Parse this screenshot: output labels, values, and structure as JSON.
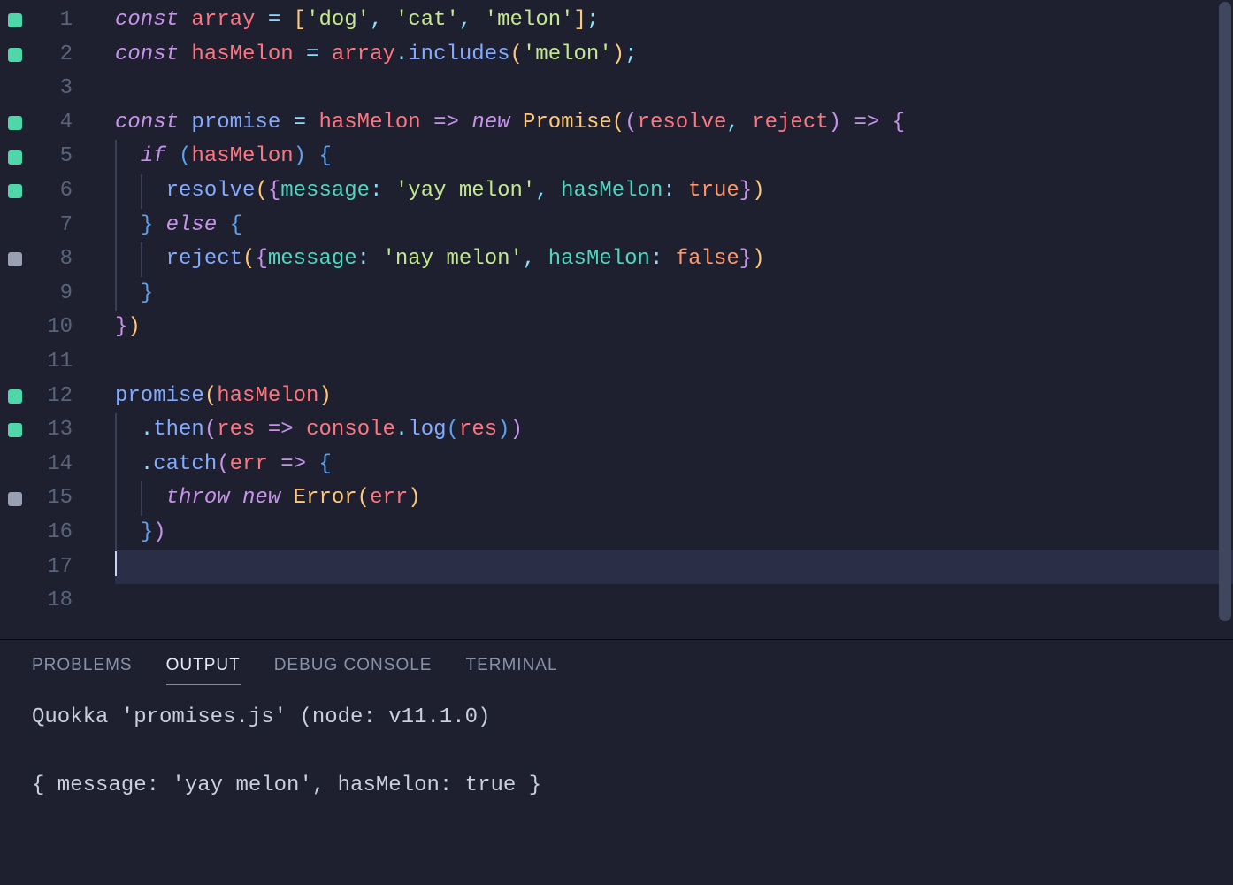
{
  "editor": {
    "lines": [
      {
        "n": 1,
        "marker": "green",
        "tokens": [
          [
            "kw",
            "const"
          ],
          [
            "var",
            " "
          ],
          [
            "ident",
            "array"
          ],
          [
            "var",
            " "
          ],
          [
            "op",
            "="
          ],
          [
            "var",
            " "
          ],
          [
            "brace-y",
            "["
          ],
          [
            "str",
            "'dog'"
          ],
          [
            "comma",
            ", "
          ],
          [
            "str",
            "'cat'"
          ],
          [
            "comma",
            ", "
          ],
          [
            "str",
            "'melon'"
          ],
          [
            "brace-y",
            "]"
          ],
          [
            "punc",
            ";"
          ]
        ]
      },
      {
        "n": 2,
        "marker": "green",
        "tokens": [
          [
            "kw",
            "const"
          ],
          [
            "var",
            " "
          ],
          [
            "ident",
            "hasMelon"
          ],
          [
            "var",
            " "
          ],
          [
            "op",
            "="
          ],
          [
            "var",
            " "
          ],
          [
            "ident",
            "array"
          ],
          [
            "punc",
            "."
          ],
          [
            "method",
            "includes"
          ],
          [
            "brace-y",
            "("
          ],
          [
            "str",
            "'melon'"
          ],
          [
            "brace-y",
            ")"
          ],
          [
            "punc",
            ";"
          ]
        ]
      },
      {
        "n": 3,
        "marker": null,
        "tokens": []
      },
      {
        "n": 4,
        "marker": "green",
        "tokens": [
          [
            "kw",
            "const"
          ],
          [
            "var",
            " "
          ],
          [
            "method",
            "promise"
          ],
          [
            "var",
            " "
          ],
          [
            "op",
            "="
          ],
          [
            "var",
            " "
          ],
          [
            "ident",
            "hasMelon"
          ],
          [
            "var",
            " "
          ],
          [
            "kw",
            "=>"
          ],
          [
            "var",
            " "
          ],
          [
            "kw",
            "new"
          ],
          [
            "var",
            " "
          ],
          [
            "cls",
            "Promise"
          ],
          [
            "brace-y",
            "("
          ],
          [
            "brace-p",
            "("
          ],
          [
            "ident",
            "resolve"
          ],
          [
            "comma",
            ", "
          ],
          [
            "ident",
            "reject"
          ],
          [
            "brace-p",
            ")"
          ],
          [
            "var",
            " "
          ],
          [
            "kw",
            "=>"
          ],
          [
            "var",
            " "
          ],
          [
            "brace-p",
            "{"
          ]
        ]
      },
      {
        "n": 5,
        "marker": "green",
        "indent": 1,
        "tokens": [
          [
            "var",
            "  "
          ],
          [
            "kw",
            "if"
          ],
          [
            "var",
            " "
          ],
          [
            "brace-b",
            "("
          ],
          [
            "ident",
            "hasMelon"
          ],
          [
            "brace-b",
            ")"
          ],
          [
            "var",
            " "
          ],
          [
            "brace-b",
            "{"
          ]
        ]
      },
      {
        "n": 6,
        "marker": "green",
        "indent": 2,
        "tokens": [
          [
            "var",
            "    "
          ],
          [
            "method",
            "resolve"
          ],
          [
            "brace-y",
            "("
          ],
          [
            "brace-p",
            "{"
          ],
          [
            "prop",
            "message"
          ],
          [
            "op",
            ":"
          ],
          [
            "var",
            " "
          ],
          [
            "str",
            "'yay melon'"
          ],
          [
            "comma",
            ", "
          ],
          [
            "prop",
            "hasMelon"
          ],
          [
            "op",
            ":"
          ],
          [
            "var",
            " "
          ],
          [
            "bool",
            "true"
          ],
          [
            "brace-p",
            "}"
          ],
          [
            "brace-y",
            ")"
          ]
        ]
      },
      {
        "n": 7,
        "marker": null,
        "indent": 1,
        "tokens": [
          [
            "var",
            "  "
          ],
          [
            "brace-b",
            "}"
          ],
          [
            "var",
            " "
          ],
          [
            "kw",
            "else"
          ],
          [
            "var",
            " "
          ],
          [
            "brace-b",
            "{"
          ]
        ]
      },
      {
        "n": 8,
        "marker": "gray",
        "indent": 2,
        "tokens": [
          [
            "var",
            "    "
          ],
          [
            "method",
            "reject"
          ],
          [
            "brace-y",
            "("
          ],
          [
            "brace-p",
            "{"
          ],
          [
            "prop",
            "message"
          ],
          [
            "op",
            ":"
          ],
          [
            "var",
            " "
          ],
          [
            "str",
            "'nay melon'"
          ],
          [
            "comma",
            ", "
          ],
          [
            "prop",
            "hasMelon"
          ],
          [
            "op",
            ":"
          ],
          [
            "var",
            " "
          ],
          [
            "bool",
            "false"
          ],
          [
            "brace-p",
            "}"
          ],
          [
            "brace-y",
            ")"
          ]
        ]
      },
      {
        "n": 9,
        "marker": null,
        "indent": 1,
        "tokens": [
          [
            "var",
            "  "
          ],
          [
            "brace-b",
            "}"
          ]
        ]
      },
      {
        "n": 10,
        "marker": null,
        "tokens": [
          [
            "brace-p",
            "}"
          ],
          [
            "brace-y",
            ")"
          ]
        ]
      },
      {
        "n": 11,
        "marker": null,
        "tokens": []
      },
      {
        "n": 12,
        "marker": "green",
        "tokens": [
          [
            "method",
            "promise"
          ],
          [
            "brace-y",
            "("
          ],
          [
            "ident",
            "hasMelon"
          ],
          [
            "brace-y",
            ")"
          ]
        ]
      },
      {
        "n": 13,
        "marker": "green",
        "indent": 1,
        "tokens": [
          [
            "var",
            "  "
          ],
          [
            "punc",
            "."
          ],
          [
            "method",
            "then"
          ],
          [
            "brace-p",
            "("
          ],
          [
            "ident",
            "res"
          ],
          [
            "var",
            " "
          ],
          [
            "kw",
            "=>"
          ],
          [
            "var",
            " "
          ],
          [
            "ident",
            "console"
          ],
          [
            "punc",
            "."
          ],
          [
            "method",
            "log"
          ],
          [
            "brace-b",
            "("
          ],
          [
            "ident",
            "res"
          ],
          [
            "brace-b",
            ")"
          ],
          [
            "brace-p",
            ")"
          ]
        ]
      },
      {
        "n": 14,
        "marker": null,
        "indent": 1,
        "tokens": [
          [
            "var",
            "  "
          ],
          [
            "punc",
            "."
          ],
          [
            "method",
            "catch"
          ],
          [
            "brace-p",
            "("
          ],
          [
            "ident",
            "err"
          ],
          [
            "var",
            " "
          ],
          [
            "kw",
            "=>"
          ],
          [
            "var",
            " "
          ],
          [
            "brace-b",
            "{"
          ]
        ]
      },
      {
        "n": 15,
        "marker": "gray",
        "indent": 2,
        "tokens": [
          [
            "var",
            "    "
          ],
          [
            "kw",
            "throw"
          ],
          [
            "var",
            " "
          ],
          [
            "kw",
            "new"
          ],
          [
            "var",
            " "
          ],
          [
            "cls",
            "Error"
          ],
          [
            "brace-y",
            "("
          ],
          [
            "ident",
            "err"
          ],
          [
            "brace-y",
            ")"
          ]
        ]
      },
      {
        "n": 16,
        "marker": null,
        "indent": 1,
        "tokens": [
          [
            "var",
            "  "
          ],
          [
            "brace-b",
            "}"
          ],
          [
            "brace-p",
            ")"
          ]
        ]
      },
      {
        "n": 17,
        "marker": null,
        "current": true,
        "cursor": true,
        "tokens": []
      },
      {
        "n": 18,
        "marker": null,
        "tokens": []
      }
    ]
  },
  "panel": {
    "tabs": {
      "problems": "PROBLEMS",
      "output": "OUTPUT",
      "debug": "DEBUG CONSOLE",
      "terminal": "TERMINAL"
    },
    "active_tab": "output",
    "output_lines": [
      "Quokka 'promises.js' (node: v11.1.0)",
      "",
      "{ message: 'yay melon', hasMelon: true }"
    ]
  }
}
